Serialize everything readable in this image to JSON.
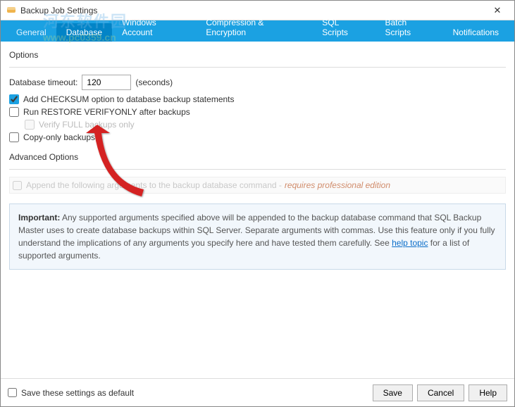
{
  "window": {
    "title": "Backup Job Settings"
  },
  "tabs": {
    "items": [
      {
        "label": "General"
      },
      {
        "label": "Database"
      },
      {
        "label": "Windows Account"
      },
      {
        "label": "Compression & Encryption"
      },
      {
        "label": "SQL Scripts"
      },
      {
        "label": "Batch Scripts"
      },
      {
        "label": "Notifications"
      }
    ]
  },
  "options": {
    "legend": "Options",
    "timeout_label": "Database timeout:",
    "timeout_value": "120",
    "timeout_unit": "(seconds)",
    "checksum": "Add CHECKSUM option to database backup statements",
    "verifyonly": "Run RESTORE VERIFYONLY after backups",
    "verifyfull": "Verify FULL backups only",
    "copyonly": "Copy-only backups"
  },
  "advanced": {
    "legend": "Advanced Options",
    "append_args": "Append the following arguments to the backup database command - ",
    "requires": "requires professional edition"
  },
  "info": {
    "important": "Important:",
    "text_before": " Any supported arguments specified above will be appended to the backup database command that SQL Backup Master uses to create database backups within SQL Server. Separate arguments with commas. Use this feature only if you fully understand the implications of any arguments you specify here and have tested them carefully. See ",
    "link": "help topic",
    "text_after": " for a list of supported arguments."
  },
  "footer": {
    "save_default": "Save these settings as default",
    "save": "Save",
    "cancel": "Cancel",
    "help": "Help"
  },
  "watermark": {
    "cn": "河东软件园",
    "url": "www.pc0359.cn"
  }
}
